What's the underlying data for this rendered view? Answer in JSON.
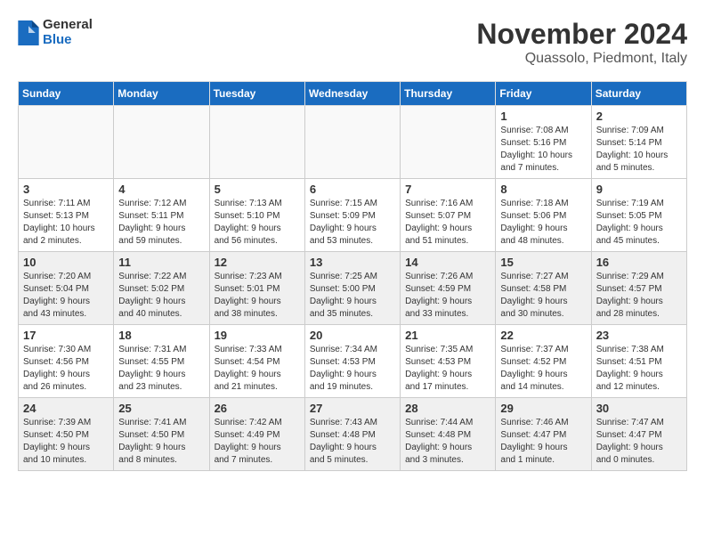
{
  "logo": {
    "general": "General",
    "blue": "Blue"
  },
  "title": "November 2024",
  "location": "Quassolo, Piedmont, Italy",
  "weekdays": [
    "Sunday",
    "Monday",
    "Tuesday",
    "Wednesday",
    "Thursday",
    "Friday",
    "Saturday"
  ],
  "weeks": [
    [
      {
        "day": "",
        "info": ""
      },
      {
        "day": "",
        "info": ""
      },
      {
        "day": "",
        "info": ""
      },
      {
        "day": "",
        "info": ""
      },
      {
        "day": "",
        "info": ""
      },
      {
        "day": "1",
        "info": "Sunrise: 7:08 AM\nSunset: 5:16 PM\nDaylight: 10 hours\nand 7 minutes."
      },
      {
        "day": "2",
        "info": "Sunrise: 7:09 AM\nSunset: 5:14 PM\nDaylight: 10 hours\nand 5 minutes."
      }
    ],
    [
      {
        "day": "3",
        "info": "Sunrise: 7:11 AM\nSunset: 5:13 PM\nDaylight: 10 hours\nand 2 minutes."
      },
      {
        "day": "4",
        "info": "Sunrise: 7:12 AM\nSunset: 5:11 PM\nDaylight: 9 hours\nand 59 minutes."
      },
      {
        "day": "5",
        "info": "Sunrise: 7:13 AM\nSunset: 5:10 PM\nDaylight: 9 hours\nand 56 minutes."
      },
      {
        "day": "6",
        "info": "Sunrise: 7:15 AM\nSunset: 5:09 PM\nDaylight: 9 hours\nand 53 minutes."
      },
      {
        "day": "7",
        "info": "Sunrise: 7:16 AM\nSunset: 5:07 PM\nDaylight: 9 hours\nand 51 minutes."
      },
      {
        "day": "8",
        "info": "Sunrise: 7:18 AM\nSunset: 5:06 PM\nDaylight: 9 hours\nand 48 minutes."
      },
      {
        "day": "9",
        "info": "Sunrise: 7:19 AM\nSunset: 5:05 PM\nDaylight: 9 hours\nand 45 minutes."
      }
    ],
    [
      {
        "day": "10",
        "info": "Sunrise: 7:20 AM\nSunset: 5:04 PM\nDaylight: 9 hours\nand 43 minutes."
      },
      {
        "day": "11",
        "info": "Sunrise: 7:22 AM\nSunset: 5:02 PM\nDaylight: 9 hours\nand 40 minutes."
      },
      {
        "day": "12",
        "info": "Sunrise: 7:23 AM\nSunset: 5:01 PM\nDaylight: 9 hours\nand 38 minutes."
      },
      {
        "day": "13",
        "info": "Sunrise: 7:25 AM\nSunset: 5:00 PM\nDaylight: 9 hours\nand 35 minutes."
      },
      {
        "day": "14",
        "info": "Sunrise: 7:26 AM\nSunset: 4:59 PM\nDaylight: 9 hours\nand 33 minutes."
      },
      {
        "day": "15",
        "info": "Sunrise: 7:27 AM\nSunset: 4:58 PM\nDaylight: 9 hours\nand 30 minutes."
      },
      {
        "day": "16",
        "info": "Sunrise: 7:29 AM\nSunset: 4:57 PM\nDaylight: 9 hours\nand 28 minutes."
      }
    ],
    [
      {
        "day": "17",
        "info": "Sunrise: 7:30 AM\nSunset: 4:56 PM\nDaylight: 9 hours\nand 26 minutes."
      },
      {
        "day": "18",
        "info": "Sunrise: 7:31 AM\nSunset: 4:55 PM\nDaylight: 9 hours\nand 23 minutes."
      },
      {
        "day": "19",
        "info": "Sunrise: 7:33 AM\nSunset: 4:54 PM\nDaylight: 9 hours\nand 21 minutes."
      },
      {
        "day": "20",
        "info": "Sunrise: 7:34 AM\nSunset: 4:53 PM\nDaylight: 9 hours\nand 19 minutes."
      },
      {
        "day": "21",
        "info": "Sunrise: 7:35 AM\nSunset: 4:53 PM\nDaylight: 9 hours\nand 17 minutes."
      },
      {
        "day": "22",
        "info": "Sunrise: 7:37 AM\nSunset: 4:52 PM\nDaylight: 9 hours\nand 14 minutes."
      },
      {
        "day": "23",
        "info": "Sunrise: 7:38 AM\nSunset: 4:51 PM\nDaylight: 9 hours\nand 12 minutes."
      }
    ],
    [
      {
        "day": "24",
        "info": "Sunrise: 7:39 AM\nSunset: 4:50 PM\nDaylight: 9 hours\nand 10 minutes."
      },
      {
        "day": "25",
        "info": "Sunrise: 7:41 AM\nSunset: 4:50 PM\nDaylight: 9 hours\nand 8 minutes."
      },
      {
        "day": "26",
        "info": "Sunrise: 7:42 AM\nSunset: 4:49 PM\nDaylight: 9 hours\nand 7 minutes."
      },
      {
        "day": "27",
        "info": "Sunrise: 7:43 AM\nSunset: 4:48 PM\nDaylight: 9 hours\nand 5 minutes."
      },
      {
        "day": "28",
        "info": "Sunrise: 7:44 AM\nSunset: 4:48 PM\nDaylight: 9 hours\nand 3 minutes."
      },
      {
        "day": "29",
        "info": "Sunrise: 7:46 AM\nSunset: 4:47 PM\nDaylight: 9 hours\nand 1 minute."
      },
      {
        "day": "30",
        "info": "Sunrise: 7:47 AM\nSunset: 4:47 PM\nDaylight: 9 hours\nand 0 minutes."
      }
    ]
  ]
}
